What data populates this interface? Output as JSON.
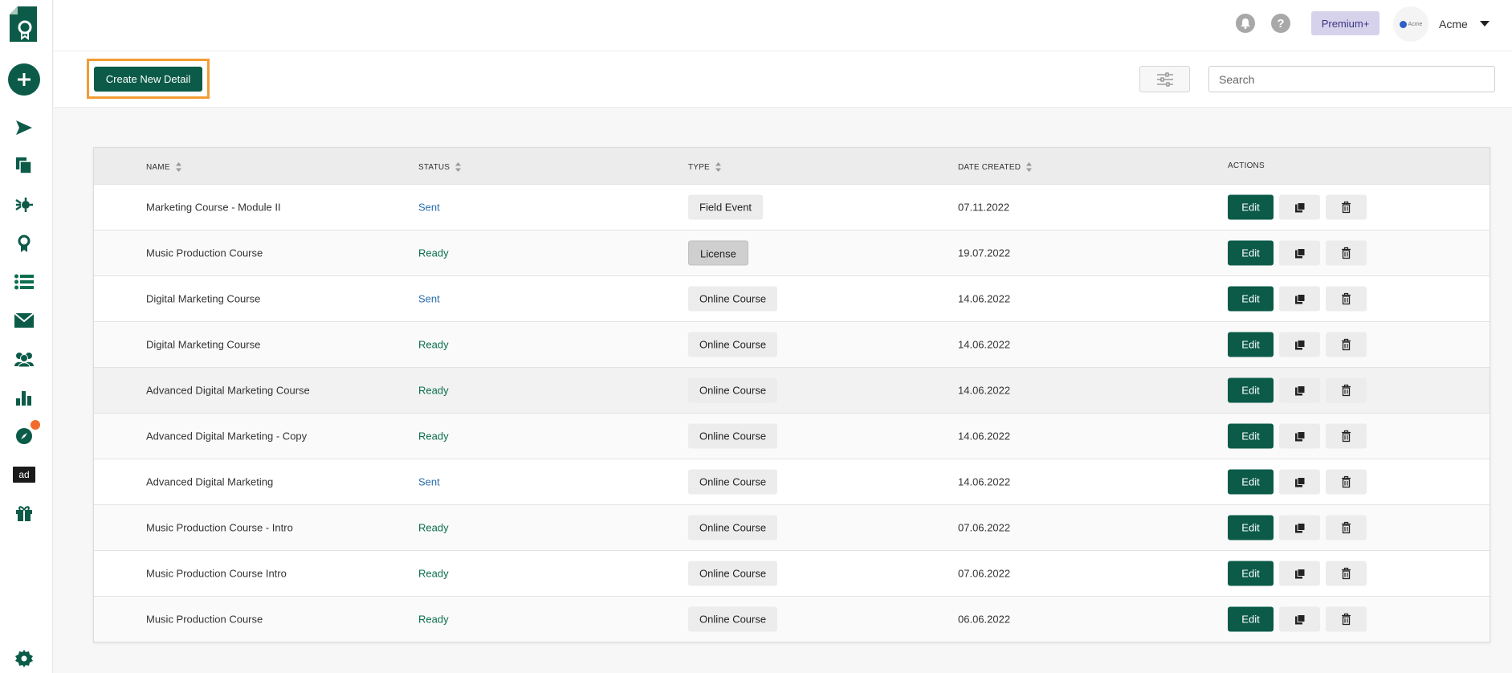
{
  "header": {
    "premium_label": "Premium+",
    "account_name": "Acme",
    "avatar_text": "Acme",
    "help_glyph": "?"
  },
  "toolbar": {
    "create_label": "Create New Detail",
    "search_placeholder": "Search"
  },
  "sidebar": {
    "items": [
      {
        "icon": "add-icon"
      },
      {
        "icon": "send-icon"
      },
      {
        "icon": "copies-icon"
      },
      {
        "icon": "integrations-icon"
      },
      {
        "icon": "certificate-icon"
      },
      {
        "icon": "list-icon",
        "active": true
      },
      {
        "icon": "mail-icon"
      },
      {
        "icon": "users-icon"
      },
      {
        "icon": "analytics-icon"
      },
      {
        "icon": "compass-icon",
        "notification": true
      },
      {
        "icon": "ad-icon",
        "label": "ad"
      },
      {
        "icon": "gift-icon"
      },
      {
        "icon": "settings-icon"
      }
    ]
  },
  "table": {
    "columns": {
      "name": "NAME",
      "status": "STATUS",
      "type": "TYPE",
      "date": "DATE CREATED",
      "actions": "ACTIONS"
    },
    "edit_label": "Edit",
    "rows": [
      {
        "name": "Marketing Course - Module II",
        "status": "Sent",
        "type": "Field Event",
        "date": "07.11.2022"
      },
      {
        "name": "Music Production Course",
        "status": "Ready",
        "type": "License",
        "date": "19.07.2022"
      },
      {
        "name": "Digital Marketing Course",
        "status": "Sent",
        "type": "Online Course",
        "date": "14.06.2022"
      },
      {
        "name": "Digital Marketing Course",
        "status": "Ready",
        "type": "Online Course",
        "date": "14.06.2022"
      },
      {
        "name": "Advanced Digital Marketing Course",
        "status": "Ready",
        "type": "Online Course",
        "date": "14.06.2022"
      },
      {
        "name": "Advanced Digital Marketing - Copy",
        "status": "Ready",
        "type": "Online Course",
        "date": "14.06.2022"
      },
      {
        "name": "Advanced Digital Marketing",
        "status": "Sent",
        "type": "Online Course",
        "date": "14.06.2022"
      },
      {
        "name": "Music Production Course - Intro",
        "status": "Ready",
        "type": "Online Course",
        "date": "07.06.2022"
      },
      {
        "name": "Music Production Course Intro",
        "status": "Ready",
        "type": "Online Course",
        "date": "07.06.2022"
      },
      {
        "name": "Music Production Course",
        "status": "Ready",
        "type": "Online Course",
        "date": "06.06.2022"
      }
    ]
  },
  "colors": {
    "brand": "#0b5b48",
    "highlight": "#f39c34",
    "notification": "#f26b2a",
    "status_sent": "#2a6fb0",
    "status_ready": "#0b6e4f"
  }
}
